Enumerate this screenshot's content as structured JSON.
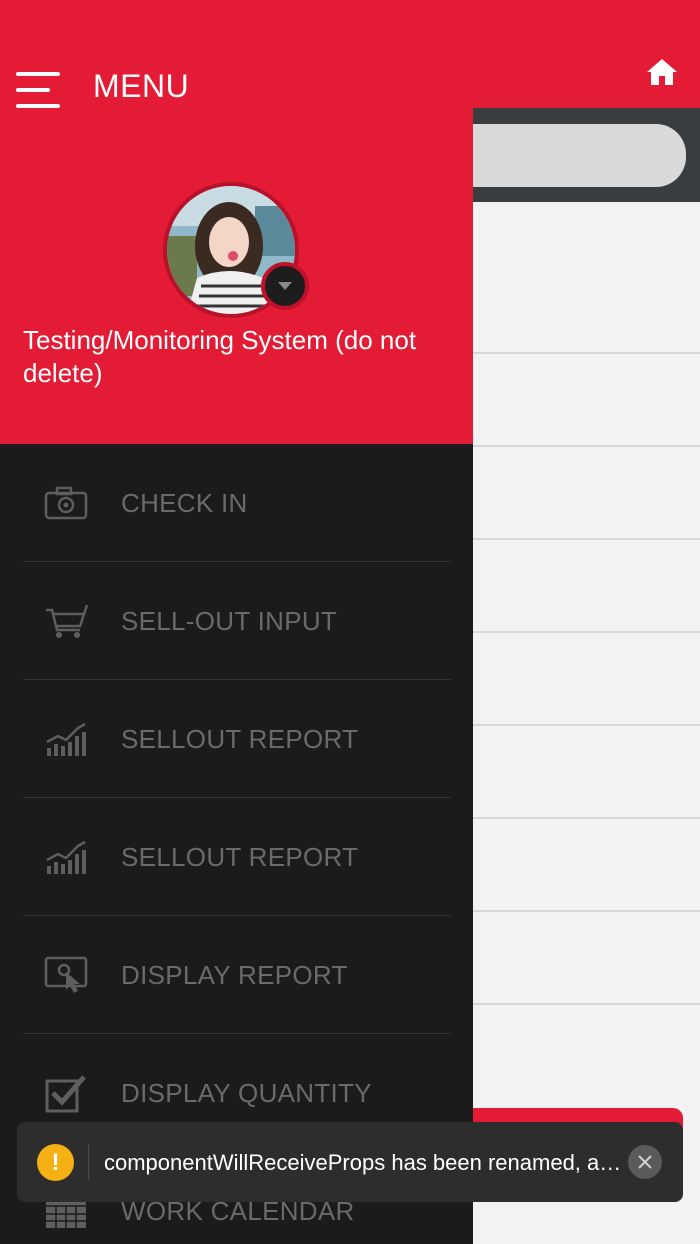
{
  "header": {
    "menu_title": "MENU"
  },
  "user": {
    "name": "Testing/Monitoring System (do not delete)"
  },
  "menu": {
    "items": [
      {
        "label": "CHECK IN",
        "icon": "camera-icon"
      },
      {
        "label": "SELL-OUT INPUT",
        "icon": "cart-icon"
      },
      {
        "label": "SELLOUT REPORT",
        "icon": "chart-icon"
      },
      {
        "label": "SELLOUT REPORT",
        "icon": "chart-icon"
      },
      {
        "label": "DISPLAY REPORT",
        "icon": "display-touch-icon"
      },
      {
        "label": "DISPLAY QUANTITY",
        "icon": "checkbox-icon"
      },
      {
        "label": "WORK CALENDAR",
        "icon": "calendar-icon"
      }
    ]
  },
  "toast": {
    "message": "componentWillReceiveProps has been renamed, and is not recommended for use in strict mode."
  },
  "colors": {
    "brand_red": "#e31b34",
    "drawer_bg": "#1b1b1b",
    "menu_text": "#6a6a6a",
    "warning": "#f5b014"
  }
}
